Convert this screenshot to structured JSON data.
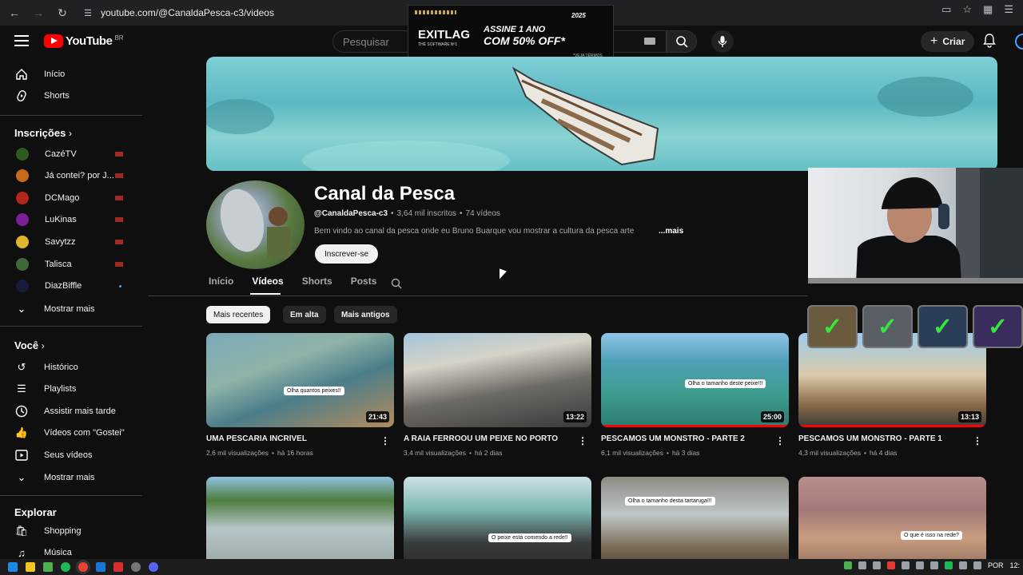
{
  "browser": {
    "url": "youtube.com/@CanaldaPesca-c3/videos"
  },
  "header": {
    "logo_text": "YouTube",
    "logo_country": "BR",
    "search_placeholder": "Pesquisar",
    "create_label": "Criar"
  },
  "ad": {
    "brand": "EXITLAG",
    "sub": "THE SOFTWARE Nº1",
    "line1": "ASSINE 1 ANO",
    "line2": "COM 50% OFF*",
    "terms": "*VEJA TERMOS",
    "year": "2025"
  },
  "sidebar": {
    "main": [
      {
        "label": "Início",
        "icon": "home-icon"
      },
      {
        "label": "Shorts",
        "icon": "shorts-icon"
      }
    ],
    "subscriptions_title": "Inscrições",
    "subscriptions": [
      {
        "label": "CazéTV",
        "color": "#2d5a1e",
        "status": "live"
      },
      {
        "label": "Já contei? por J...",
        "color": "#c8691c",
        "status": "live"
      },
      {
        "label": "DCMago",
        "color": "#b3261e",
        "status": "live"
      },
      {
        "label": "LuKinas",
        "color": "#7a1f9a",
        "status": "live"
      },
      {
        "label": "Savytzz",
        "color": "#e0b52a",
        "status": "live"
      },
      {
        "label": "Talisca",
        "color": "#3e6a3a",
        "status": "live"
      },
      {
        "label": "DiazBiffle",
        "color": "#1a1a3a",
        "status": "new"
      }
    ],
    "show_more": "Mostrar mais",
    "you_title": "Você",
    "you": [
      {
        "label": "Histórico",
        "icon": "history-icon"
      },
      {
        "label": "Playlists",
        "icon": "playlists-icon"
      },
      {
        "label": "Assistir mais tarde",
        "icon": "watch-later-icon"
      },
      {
        "label": "Vídeos com \"Gostei\"",
        "icon": "like-icon"
      },
      {
        "label": "Seus vídeos",
        "icon": "your-videos-icon"
      }
    ],
    "show_more_2": "Mostrar mais",
    "explore_title": "Explorar",
    "explore": [
      {
        "label": "Shopping",
        "icon": "shopping-icon"
      },
      {
        "label": "Música",
        "icon": "music-icon"
      }
    ]
  },
  "channel": {
    "name": "Canal da Pesca",
    "handle": "@CanaldaPesca-c3",
    "subscribers": "3,64 mil inscritos",
    "videos": "74 vídeos",
    "separator": "•",
    "description": "Bem vindo ao canal da pesca onde eu Bruno Buarque vou mostrar a cultura da pesca arte",
    "more": "...mais",
    "subscribe": "Inscrever-se"
  },
  "tabs": [
    "Início",
    "Vídeos",
    "Shorts",
    "Posts"
  ],
  "chips": [
    "Mais recentes",
    "Em alta",
    "Mais antigos"
  ],
  "videos": [
    {
      "title": "UMA PESCARIA INCRÍVEL",
      "views": "2,6 mil visualizações",
      "age": "há 16 horas",
      "duration": "21:43",
      "caption": "Olha quantos peixes!!",
      "progress": 0.0
    },
    {
      "title": "A RAIA FERROOU UM PEIXE NO PORTO",
      "views": "3,4 mil visualizações",
      "age": "há 2 dias",
      "duration": "13:22",
      "caption": "",
      "progress": 0.0
    },
    {
      "title": "PESCAMOS UM MONSTRO - PARTE 2",
      "views": "6,1 mil visualizações",
      "age": "há 3 dias",
      "duration": "25:00",
      "caption": "Olha o tamanho deste peixe!!!",
      "progress": 1.0
    },
    {
      "title": "PESCAMOS UM MONSTRO - PARTE 1",
      "views": "4,3 mil visualizações",
      "age": "há 4 dias",
      "duration": "13:13",
      "caption": "",
      "progress": 1.0
    },
    {
      "title": "",
      "views": "",
      "age": "",
      "duration": "",
      "caption": "",
      "progress": 0.0
    },
    {
      "title": "",
      "views": "",
      "age": "",
      "duration": "",
      "caption": "O peixe está comendo a rede!!",
      "progress": 0.0
    },
    {
      "title": "",
      "views": "",
      "age": "",
      "duration": "",
      "caption": "Olha o tamanho desta tartaruga!!!",
      "progress": 0.0
    },
    {
      "title": "",
      "views": "",
      "age": "",
      "duration": "",
      "caption": "O que é isso na rede?",
      "progress": 0.0
    }
  ],
  "meta_separator": "•",
  "taskbar": {
    "lang": "POR",
    "time": "12:"
  },
  "colors": {
    "accent_red": "#ff0000",
    "bg": "#0f0f0f",
    "rank_check": "#36e63b"
  }
}
